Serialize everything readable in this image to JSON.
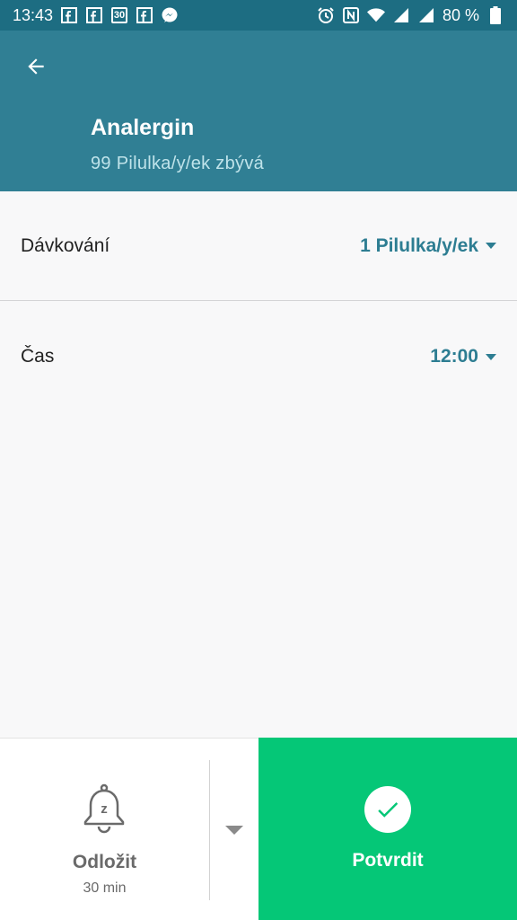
{
  "status_bar": {
    "time": "13:43",
    "calendar_badge": "30",
    "battery": "80 %"
  },
  "header": {
    "title": "Analergin",
    "subtitle": "99 Pilulka/y/ek zbývá"
  },
  "dosage": {
    "label": "Dávkování",
    "value": "1 Pilulka/y/ek"
  },
  "time_row": {
    "label": "Čas",
    "value": "12:00"
  },
  "snooze": {
    "label": "Odložit",
    "duration": "30 min",
    "bell_letter": "z"
  },
  "confirm": {
    "label": "Potvrdit"
  },
  "colors": {
    "header": "#307f94",
    "status_bar": "#1d6d82",
    "accent": "#2d7d92",
    "confirm": "#05c777"
  }
}
